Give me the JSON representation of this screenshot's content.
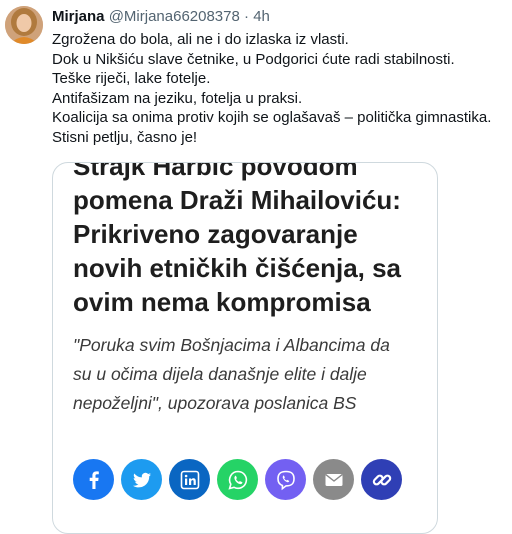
{
  "tweet": {
    "author_name": "Mirjana",
    "author_handle": "@Mirjana66208378",
    "separator": "·",
    "time": "4h",
    "lines": [
      "Zgrožena do bola, ali ne i do izlaska iz vlasti.",
      "Dok u Nikšiću slave četnike, u Podgorici ćute radi stabilnosti.",
      "Teške riječi, lake fotelje.",
      "Antifašizam na jeziku, fotelja u praksi.",
      "Koalicija sa onima protiv kojih se oglašavaš –  politička gimnastika.",
      "Stisni petlju, časno je!"
    ]
  },
  "card": {
    "title_lines": [
      "Strajk Harbić povodom",
      "pomena Draži Mihailoviću:",
      "Prikriveno zagovaranje",
      "novih etničkih čišćenja, sa",
      "ovim nema kompromisa"
    ],
    "quote_lines": [
      "\"Poruka svim Bošnjacima i Albancima da",
      "su u očima dijela današnje elite i dalje",
      "nepoželjni\", upozorava poslanica BS"
    ]
  },
  "share_buttons": [
    {
      "icon": "facebook-icon",
      "color": "#1877f2"
    },
    {
      "icon": "twitter-icon",
      "color": "#1d9bf0"
    },
    {
      "icon": "linkedin-icon",
      "color": "#0a66c2"
    },
    {
      "icon": "whatsapp-icon",
      "color": "#25d366"
    },
    {
      "icon": "viber-icon",
      "color": "#7360f2"
    },
    {
      "icon": "email-icon",
      "color": "#8a8a8a"
    },
    {
      "icon": "copy-link-icon",
      "color": "#2f3fb5"
    }
  ]
}
